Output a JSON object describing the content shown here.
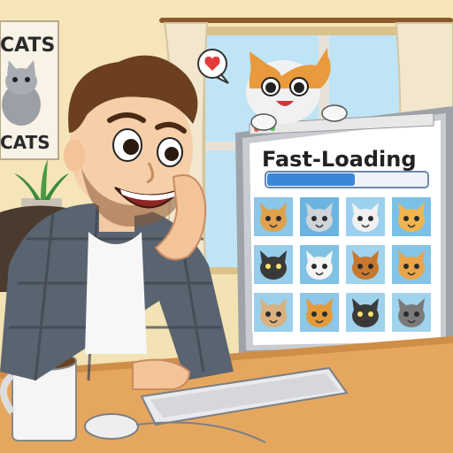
{
  "poster": {
    "top_text": "CATS",
    "bottom_text": "CATS"
  },
  "browser": {
    "title": "Fast-Loading",
    "progress_fraction": 0.55
  },
  "speech_bubble": {
    "icon": "heart-icon"
  },
  "cat_grid": {
    "rows": 3,
    "cols": 4,
    "tiles": [
      {
        "bg": "#8ac7e8",
        "fur": "#e0a14d",
        "eye": "#2b2b2b"
      },
      {
        "bg": "#6bb4e0",
        "fur": "#cfd4da",
        "eye": "#2b2b2b"
      },
      {
        "bg": "#9bd0ef",
        "fur": "#f1f1f1",
        "eye": "#2b2b2b"
      },
      {
        "bg": "#7bc0e6",
        "fur": "#f2b54e",
        "eye": "#2b2b2b"
      },
      {
        "bg": "#95cdea",
        "fur": "#3a3a3a",
        "eye": "#f7e36b"
      },
      {
        "bg": "#7fc2e4",
        "fur": "#f5f5f5",
        "eye": "#2b2b2b"
      },
      {
        "bg": "#9fd3ee",
        "fur": "#c7782e",
        "eye": "#2b2b2b"
      },
      {
        "bg": "#84c4e6",
        "fur": "#e9a44a",
        "eye": "#2b2b2b"
      },
      {
        "bg": "#9ad0ec",
        "fur": "#d9b07e",
        "eye": "#2b2b2b"
      },
      {
        "bg": "#8cc6e8",
        "fur": "#e39a3a",
        "eye": "#2b2b2b"
      },
      {
        "bg": "#9ed1ec",
        "fur": "#3b3b3b",
        "eye": "#f7e36b"
      },
      {
        "bg": "#a0d3ee",
        "fur": "#7a7a7a",
        "eye": "#2b2b2b"
      }
    ]
  },
  "colors": {
    "wall": "#f3e2b3",
    "desk": "#e5a75e",
    "monitor": "#c9ccd1",
    "progress_fill": "#3a86d8",
    "shirt": "#5a6470"
  }
}
